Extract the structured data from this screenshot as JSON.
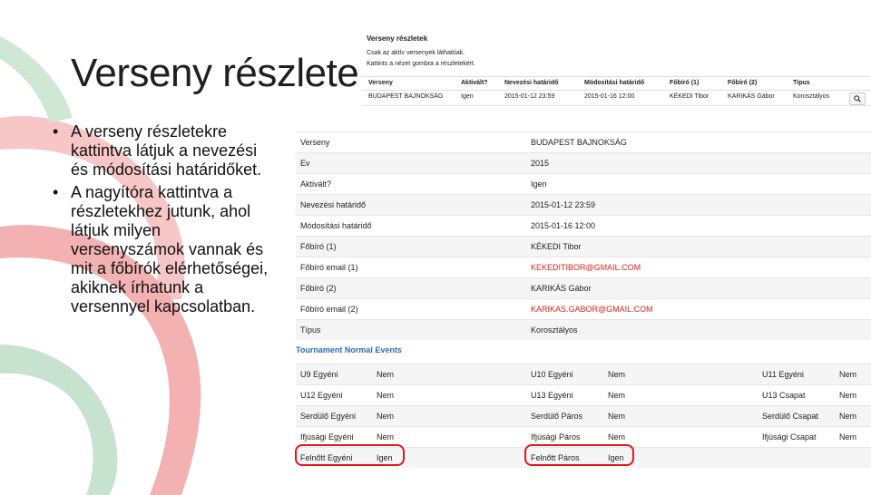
{
  "slide": {
    "title": "Verseny részletek",
    "bullets": [
      "A verseny részletekre kattintva látjuk a nevezési és módosítási határidőket.",
      "A nagyítóra kattintva a részletekhez jutunk, ahol látjuk milyen versenyszámok vannak és mit a főbírók elérhetőségei, akiknek írhatunk a versennyel kapcsolatban."
    ]
  },
  "list_panel": {
    "title": "Verseny részletek",
    "note1": "Csak az aktív versenyek láthatóak.",
    "note2": "Kattints a nézet gombra a részletekért.",
    "headers": [
      "Verseny",
      "Aktivált?",
      "Nevezési határidő",
      "Módosítási határidő",
      "Főbíró (1)",
      "Főbíró (2)",
      "Típus"
    ],
    "row": [
      "BUDAPEST BAJNOKSÁG",
      "Igen",
      "2015-01-12 23:59",
      "2015-01-16 12:00",
      "KÉKEDI Tibor",
      "KARIKÁS Gábor",
      "Korosztályos"
    ],
    "zoom_icon": "magnifier-icon"
  },
  "details": [
    {
      "label": "Verseny",
      "value": "BUDAPEST BAJNOKSÁG"
    },
    {
      "label": "Ev",
      "value": "2015"
    },
    {
      "label": "Aktivált?",
      "value": "Igen"
    },
    {
      "label": "Nevezési határidő",
      "value": "2015-01-12 23:59"
    },
    {
      "label": "Módosítási határidő",
      "value": "2015-01-16 12:00"
    },
    {
      "label": "Főbíró (1)",
      "value": "KÉKEDI Tibor"
    },
    {
      "label": "Főbíró email (1)",
      "value": "KEKEDITIBOR@GMAIL.COM"
    },
    {
      "label": "Főbíró (2)",
      "value": "KARIKÁS Gábor"
    },
    {
      "label": "Főbíró email (2)",
      "value": "KARIKAS.GABOR@GMAIL.COM"
    },
    {
      "label": "Típus",
      "value": "Korosztályos"
    }
  ],
  "events": {
    "title": "Tournament Normal Events",
    "rows": [
      [
        [
          "U9 Egyéni",
          "Nem"
        ],
        [
          "U10 Egyéni",
          "Nem"
        ],
        [
          "U11 Egyéni",
          "Nem"
        ]
      ],
      [
        [
          "U12 Egyéni",
          "Nem"
        ],
        [
          "U13 Egyéni",
          "Nem"
        ],
        [
          "U13 Csapat",
          "Nem"
        ]
      ],
      [
        [
          "Serdülő Egyéni",
          "Nem"
        ],
        [
          "Serdülő Páros",
          "Nem"
        ],
        [
          "Serdülő Csapat",
          "Nem"
        ]
      ],
      [
        [
          "Ifjúsági Egyéni",
          "Nem"
        ],
        [
          "Ifjúsági Páros",
          "Nem"
        ],
        [
          "Ifjúsági Csapat",
          "Nem"
        ]
      ],
      [
        [
          "Felnőtt Egyéni",
          "Igen"
        ],
        [
          "Felnőtt Páros",
          "Igen"
        ]
      ]
    ]
  },
  "colors": {
    "accent_red": "#d9231c",
    "link_blue": "#2a6db5",
    "highlight": "#e0181e"
  }
}
